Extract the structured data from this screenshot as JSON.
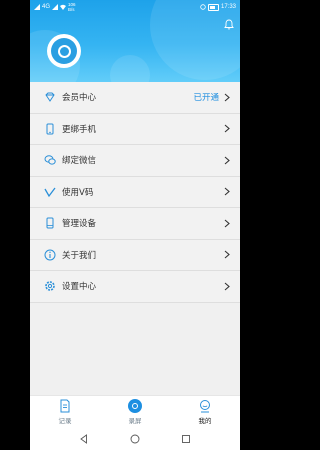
{
  "status_bar": {
    "left_text": "4G",
    "speed_top": "106",
    "speed_bottom": "B/s",
    "time": "17:33"
  },
  "header": {
    "bell_icon": "bell-icon",
    "avatar_icon": "app-logo-avatar"
  },
  "menu": [
    {
      "icon": "vip-diamond-icon",
      "label": "会员中心",
      "status": "已开通"
    },
    {
      "icon": "phone-icon",
      "label": "更绑手机",
      "status": ""
    },
    {
      "icon": "wechat-icon",
      "label": "绑定微信",
      "status": ""
    },
    {
      "icon": "v-code-icon",
      "label": "使用V码",
      "status": ""
    },
    {
      "icon": "device-icon",
      "label": "管理设备",
      "status": ""
    },
    {
      "icon": "info-icon",
      "label": "关于我们",
      "status": ""
    },
    {
      "icon": "settings-icon",
      "label": "设置中心",
      "status": ""
    }
  ],
  "bottom_nav": {
    "tabs": [
      {
        "label": "记录",
        "icon": "document-icon"
      },
      {
        "label": "录屏",
        "icon": "record-icon"
      },
      {
        "label": "我的",
        "icon": "profile-icon"
      }
    ],
    "active": "我的"
  },
  "colors": {
    "accent": "#1e8ee0",
    "header_top": "#1ea2ea",
    "header_bottom": "#62cdf9"
  }
}
